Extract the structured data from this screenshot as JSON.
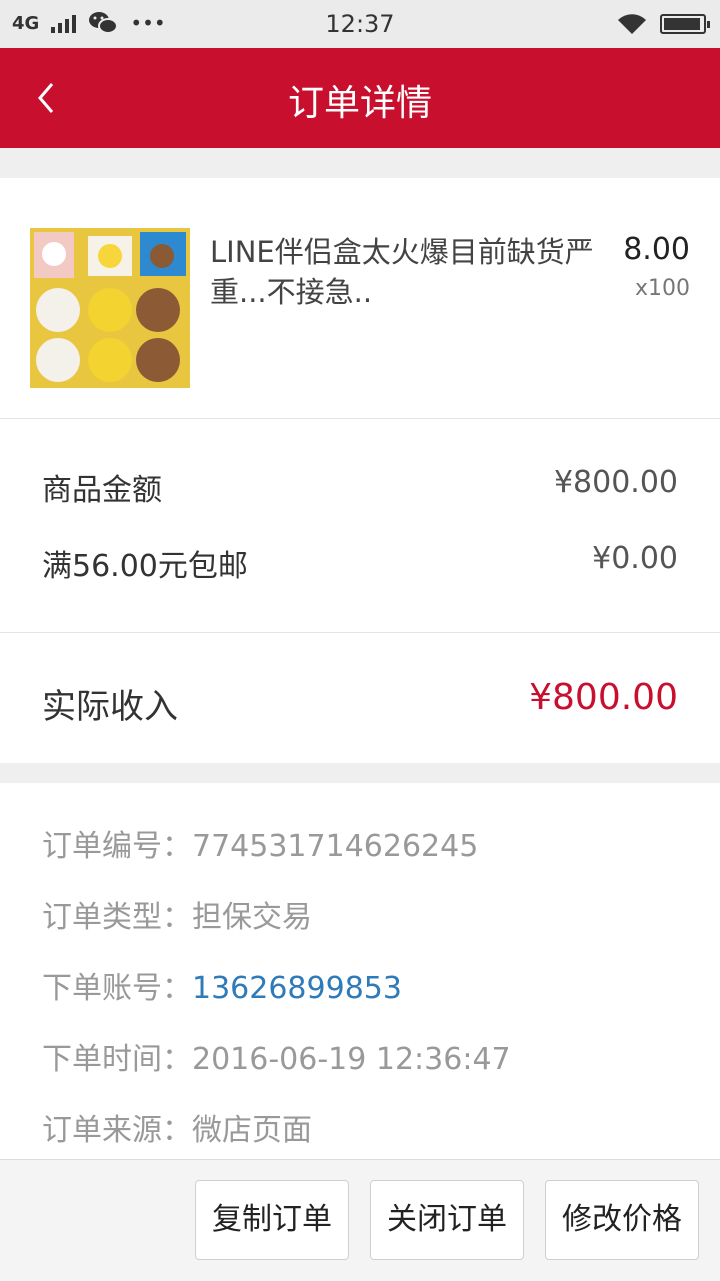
{
  "status_bar": {
    "network": "4G",
    "time": "12:37",
    "more": "•••",
    "battery_level": 0.95,
    "icons": [
      "signal-icon",
      "wechat-icon",
      "more-dots-icon",
      "wifi-icon",
      "battery-icon"
    ]
  },
  "header": {
    "title": "订单详情",
    "back_icon": "chevron-left-icon"
  },
  "product": {
    "name": "LINE伴侣盒太火爆目前缺货严重...不接急..",
    "price": "8.00",
    "quantity": "x100",
    "image": "product-thumbnail"
  },
  "amounts": {
    "goods_label": "商品金额",
    "goods_value": "¥800.00",
    "shipping_label": "满56.00元包邮",
    "shipping_value": "¥0.00"
  },
  "income": {
    "label": "实际收入",
    "value": "¥800.00"
  },
  "order_info": {
    "number_label": "订单编号：",
    "number": "774531714626245",
    "type_label": "订单类型：",
    "type": "担保交易",
    "account_label": "下单账号：",
    "account": "13626899853",
    "time_label": "下单时间：",
    "time": "2016-06-19 12:36:47",
    "source_label": "订单来源：",
    "source": "微店页面"
  },
  "actions": {
    "copy": "复制订单",
    "close": "关闭订单",
    "modify_price": "修改价格"
  },
  "colors": {
    "brand_red": "#c8102e",
    "link_blue": "#2f7ab8",
    "background": "#efefef"
  }
}
